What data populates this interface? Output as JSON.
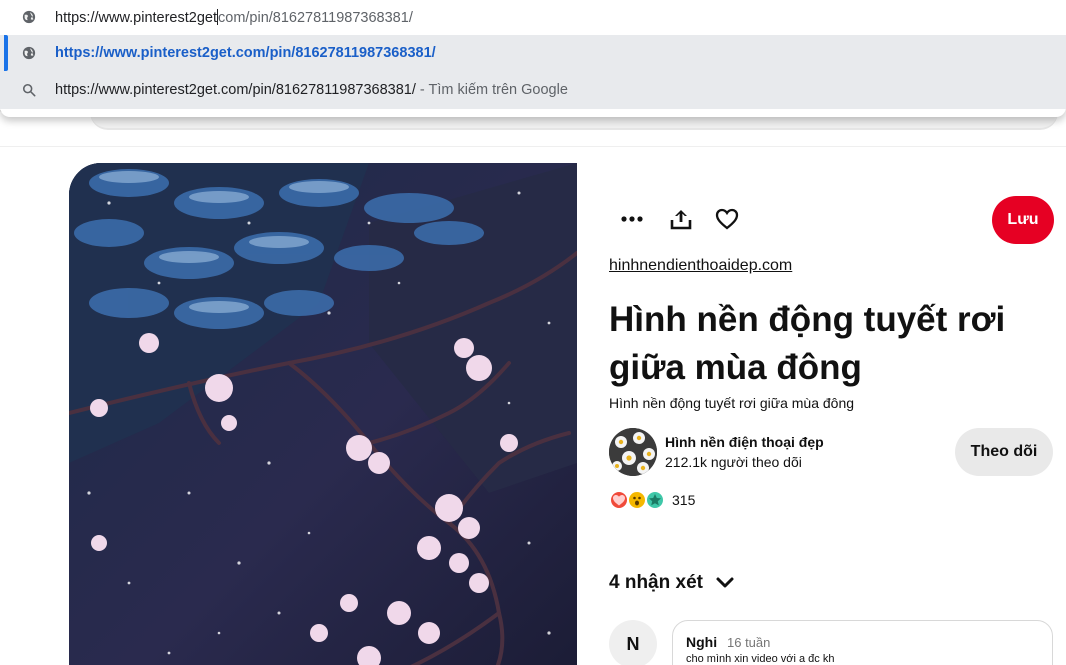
{
  "omnibox": {
    "input_prefix": "https://www.pinterest2get",
    "input_suffix": "com/pin/81627811987368381/",
    "selected_suggestion": "https://www.pinterest2get.com/pin/81627811987368381/",
    "search_suggestion": "https://www.pinterest2get.com/pin/81627811987368381/",
    "search_hint": "- Tìm kiếm trên Google"
  },
  "page_edge_glyph": "a",
  "pin": {
    "source": "hinhnendienthoaidep.com",
    "title": "Hình nền động tuyết rơi giữa mùa đông",
    "description": "Hình nền động tuyết rơi giữa mùa đông",
    "save_label": "Lưu",
    "icons": [
      "more-icon",
      "share-icon",
      "heart-icon"
    ]
  },
  "creator": {
    "name": "Hình nền điện thoại đẹp",
    "followers": "212.1k người theo dõi",
    "follow_label": "Theo dõi"
  },
  "reactions": {
    "count": "315",
    "icons": [
      "heart-eyes-icon",
      "wow-icon",
      "star-eyes-icon"
    ]
  },
  "comments": {
    "heading": "4 nhận xét",
    "items": [
      {
        "avatar_letter": "N",
        "author": "Nghi",
        "time": "16 tuần",
        "text": "cho mình xin video với a đc kh"
      }
    ]
  },
  "colors": {
    "save_button": "#e60023",
    "follow_button": "#e9e9e9",
    "omnibox_selected": "#e8eaed",
    "link_blue": "#1a5fc8"
  }
}
